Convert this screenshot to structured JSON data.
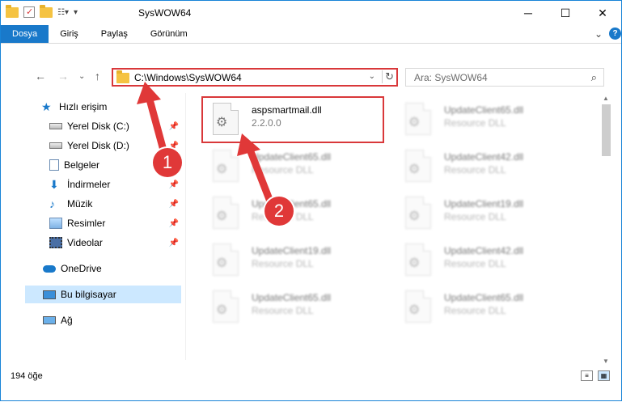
{
  "window": {
    "title": "SysWOW64",
    "minimize": "─",
    "maximize": "☐",
    "close": "✕"
  },
  "ribbon": {
    "tabs": [
      "Dosya",
      "Giriş",
      "Paylaş",
      "Görünüm"
    ],
    "active_tab": "Dosya",
    "help_glyph": "?",
    "expand_glyph": "⌄"
  },
  "nav": {
    "back": "←",
    "forward": "→",
    "recent": "⌄",
    "up": "↑",
    "address": "C:\\Windows\\SysWOW64",
    "address_dropdown": "⌄",
    "refresh": "↻",
    "search_placeholder": "Ara: SysWOW64"
  },
  "sidebar": {
    "items": [
      {
        "label": "Hızlı erişim",
        "icon": "star-icon",
        "pinned": false
      },
      {
        "label": "Yerel Disk (C:)",
        "icon": "drive-icon",
        "pinned": true
      },
      {
        "label": "Yerel Disk (D:)",
        "icon": "drive-icon",
        "pinned": true
      },
      {
        "label": "Belgeler",
        "icon": "documents-icon",
        "pinned": true
      },
      {
        "label": "İndirmeler",
        "icon": "download-icon",
        "pinned": true
      },
      {
        "label": "Müzik",
        "icon": "music-icon",
        "pinned": true
      },
      {
        "label": "Resimler",
        "icon": "pictures-icon",
        "pinned": true
      },
      {
        "label": "Videolar",
        "icon": "video-icon",
        "pinned": true
      },
      {
        "label": "OneDrive",
        "icon": "cloud-icon",
        "pinned": false
      },
      {
        "label": "Bu bilgisayar",
        "icon": "computer-icon",
        "pinned": false
      },
      {
        "label": "Ağ",
        "icon": "network-icon",
        "pinned": false
      }
    ],
    "selected": "Bu bilgisayar"
  },
  "files": [
    {
      "name": "aspsmartmail.dll",
      "detail": "2.2.0.0"
    },
    {
      "name": "UpdateClient65.dll",
      "detail": "Resource DLL"
    },
    {
      "name": "UpdateClient65.dll",
      "detail": "Resource DLL"
    },
    {
      "name": "UpdateClient42.dll",
      "detail": "Resource DLL"
    },
    {
      "name": "UpdateClient65.dll",
      "detail": "Resource DLL"
    },
    {
      "name": "UpdateClient19.dll",
      "detail": "Resource DLL"
    },
    {
      "name": "UpdateClient19.dll",
      "detail": "Resource DLL"
    },
    {
      "name": "UpdateClient42.dll",
      "detail": "Resource DLL"
    },
    {
      "name": "UpdateClient65.dll",
      "detail": "Resource DLL"
    },
    {
      "name": "UpdateClient65.dll",
      "detail": "Resource DLL"
    }
  ],
  "status": {
    "count": "194 öğe"
  },
  "annotations": {
    "badge1": "1",
    "badge2": "2",
    "color": "#e03838"
  },
  "colors": {
    "accent": "#1979ca",
    "highlight": "#d9383a",
    "selection": "#cce8ff"
  }
}
